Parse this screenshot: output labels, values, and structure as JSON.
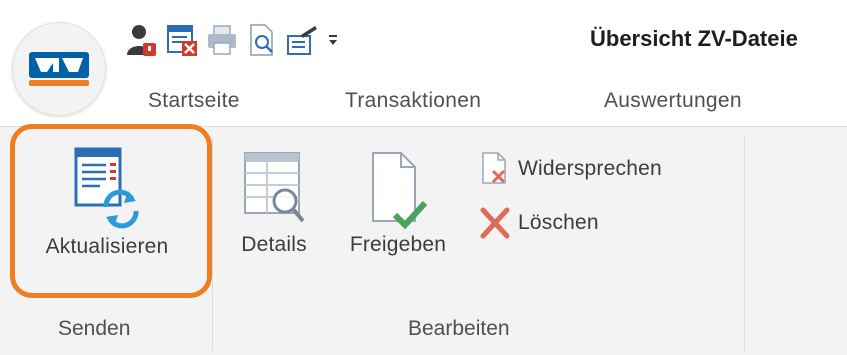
{
  "window": {
    "title": "Übersicht ZV-Dateie"
  },
  "quick_access": {
    "items": [
      {
        "name": "user-icon"
      },
      {
        "name": "delete-list-icon"
      },
      {
        "name": "print-icon"
      },
      {
        "name": "print-preview-icon"
      },
      {
        "name": "sign-icon"
      },
      {
        "name": "customize-dropdown-icon"
      }
    ]
  },
  "ribbon_tabs": [
    "Startseite",
    "Transaktionen",
    "Auswertungen"
  ],
  "ribbon": {
    "groups": [
      {
        "label": "Senden",
        "buttons": [
          {
            "label": "Aktualisieren",
            "icon": "refresh-list-icon",
            "highlighted": true
          }
        ]
      },
      {
        "label": "Bearbeiten",
        "buttons": [
          {
            "label": "Details",
            "icon": "details-magnifier-icon"
          },
          {
            "label": "Freigeben",
            "icon": "release-document-icon"
          },
          {
            "label": "Widersprechen",
            "icon": "object-document-icon"
          },
          {
            "label": "Löschen",
            "icon": "delete-x-icon"
          }
        ]
      }
    ]
  },
  "colors": {
    "highlight": "#ef7d22",
    "brand_blue": "#0060a8",
    "brand_orange": "#ef7d22",
    "ribbon_bg": "#f3f3f3"
  }
}
